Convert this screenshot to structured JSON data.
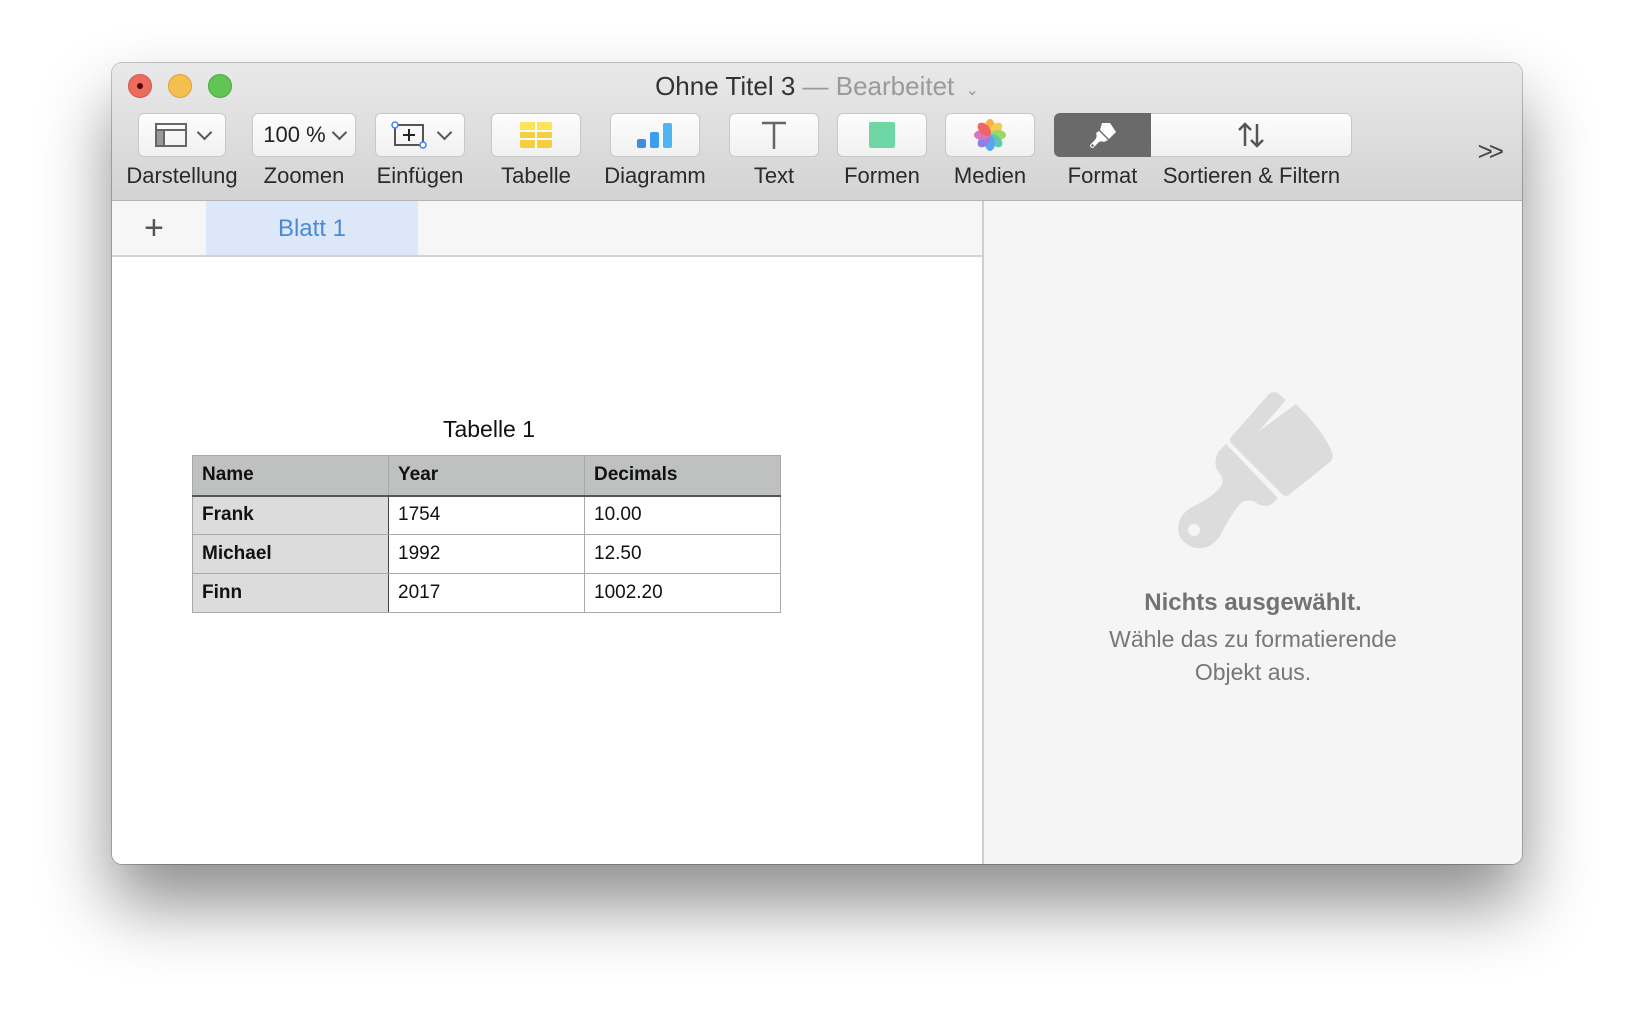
{
  "window": {
    "title": "Ohne Titel 3",
    "separator": "—",
    "status": "Bearbeitet"
  },
  "toolbar": {
    "items": [
      {
        "id": "view",
        "label": "Darstellung",
        "icon": "sidebar-layout-icon",
        "has_menu": true
      },
      {
        "id": "zoom",
        "label": "Zoomen",
        "value": "100 %",
        "has_menu": true
      },
      {
        "id": "insert",
        "label": "Einfügen",
        "icon": "insert-box-icon",
        "has_menu": true
      },
      {
        "id": "table",
        "label": "Tabelle",
        "icon": "table-icon"
      },
      {
        "id": "chart",
        "label": "Diagramm",
        "icon": "bar-chart-icon"
      },
      {
        "id": "text",
        "label": "Text",
        "icon": "text-icon"
      },
      {
        "id": "shapes",
        "label": "Formen",
        "icon": "shape-icon"
      },
      {
        "id": "media",
        "label": "Medien",
        "icon": "photos-icon"
      },
      {
        "id": "format",
        "label": "Format",
        "icon": "paintbrush-icon",
        "active": true
      },
      {
        "id": "sort",
        "label": "Sortieren & Filtern",
        "icon": "sort-arrows-icon"
      }
    ],
    "overflow": "»"
  },
  "sheets": {
    "add_label": "+",
    "tabs": [
      {
        "label": "Blatt 1",
        "active": true
      }
    ]
  },
  "table": {
    "title": "Tabelle 1",
    "columns": [
      "Name",
      "Year",
      "Decimals"
    ],
    "rows": [
      [
        "Frank",
        "1754",
        "10.00"
      ],
      [
        "Michael",
        "1992",
        "12.50"
      ],
      [
        "Finn",
        "2017",
        "1002.20"
      ]
    ]
  },
  "sidebar": {
    "empty_title": "Nichts ausgewählt.",
    "empty_line1": "Wähle das zu formatierende",
    "empty_line2": "Objekt aus."
  },
  "colors": {
    "accent": "#4a88d8",
    "active_tab_bg": "#dce8f9",
    "format_active": "#6a6a6a"
  }
}
